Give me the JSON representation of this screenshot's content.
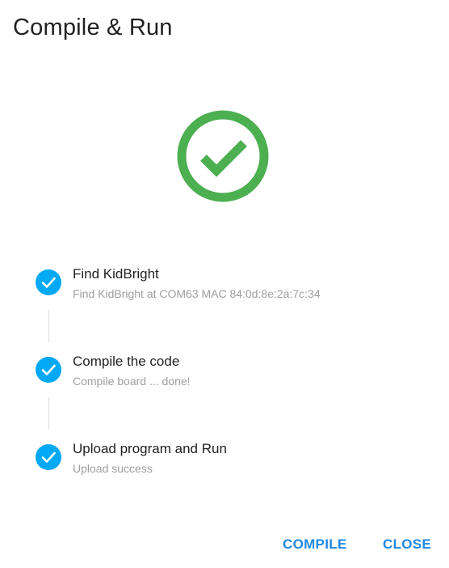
{
  "dialog": {
    "title": "Compile & Run"
  },
  "status": {
    "icon": "check-circle-icon",
    "color": "#4caf50"
  },
  "steps": [
    {
      "title": "Find KidBright",
      "subtitle": "Find KidBright at COM63 MAC 84:0d:8e:2a:7c:34",
      "state": "done",
      "icon": "check-circle-icon"
    },
    {
      "title": "Compile the code",
      "subtitle": "Compile board ... done!",
      "state": "done",
      "icon": "check-circle-icon"
    },
    {
      "title": "Upload program and Run",
      "subtitle": "Upload success",
      "state": "done",
      "icon": "check-circle-icon"
    }
  ],
  "step_color": "#03a9f4",
  "actions": {
    "compile_label": "COMPILE",
    "close_label": "CLOSE",
    "color": "#1e88e5"
  }
}
